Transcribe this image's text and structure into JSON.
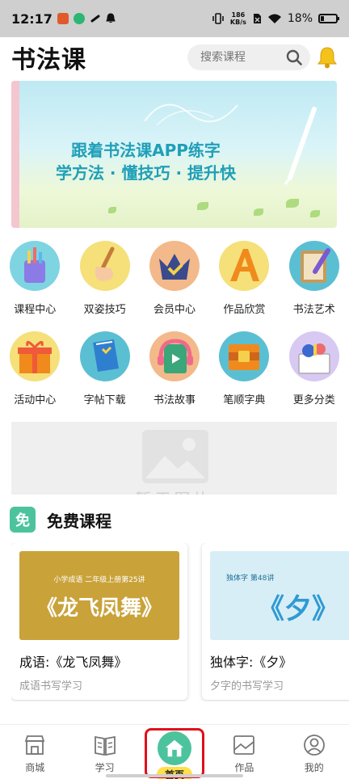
{
  "status_bar": {
    "time": "12:17",
    "net_speed_top": "186",
    "net_speed_unit": "KB/s",
    "battery": "18%"
  },
  "header": {
    "title": "书法课",
    "search_placeholder": "搜索课程"
  },
  "banner": {
    "line1": "跟着书法课APP练字",
    "line2": "学方法 · 懂技巧 · 提升快"
  },
  "categories": [
    {
      "label": "课程中心",
      "icon": "pencil-cup-icon",
      "bg": "#7fd4e2"
    },
    {
      "label": "双姿技巧",
      "icon": "hand-brush-icon",
      "bg": "#f5e07a"
    },
    {
      "label": "会员中心",
      "icon": "crown-icon",
      "bg": "#f3b98a"
    },
    {
      "label": "作品欣赏",
      "icon": "letter-a-icon",
      "bg": "#f5e07a"
    },
    {
      "label": "书法艺术",
      "icon": "notebook-pen-icon",
      "bg": "#5bbfd3"
    },
    {
      "label": "活动中心",
      "icon": "gift-box-icon",
      "bg": "#f5e07a"
    },
    {
      "label": "字帖下载",
      "icon": "book-download-icon",
      "bg": "#5bbfd3"
    },
    {
      "label": "书法故事",
      "icon": "audio-book-icon",
      "bg": "#f3b98a"
    },
    {
      "label": "笔顺字典",
      "icon": "dictionary-icon",
      "bg": "#5bbfd3"
    },
    {
      "label": "更多分类",
      "icon": "more-box-icon",
      "bg": "#d8c9f3"
    }
  ],
  "ad": {
    "text": "暂无图片"
  },
  "section": {
    "badge": "免",
    "title": "免费课程"
  },
  "courses": [
    {
      "tag": "小学成语  二年级上册第25讲",
      "thumb_text": "《龙飞凤舞》",
      "title": "成语:《龙飞凤舞》",
      "subtitle": "成语书写学习"
    },
    {
      "tag": "独体字  第48讲",
      "thumb_text": "《夕》",
      "title": "独体字:《夕》",
      "subtitle": "夕字的书写学习"
    }
  ],
  "nav": [
    {
      "label": "商城",
      "icon": "shop-icon"
    },
    {
      "label": "学习",
      "icon": "book-icon"
    },
    {
      "label": "首页",
      "icon": "home-icon",
      "active": true
    },
    {
      "label": "作品",
      "icon": "gallery-icon"
    },
    {
      "label": "我的",
      "icon": "profile-icon"
    }
  ]
}
